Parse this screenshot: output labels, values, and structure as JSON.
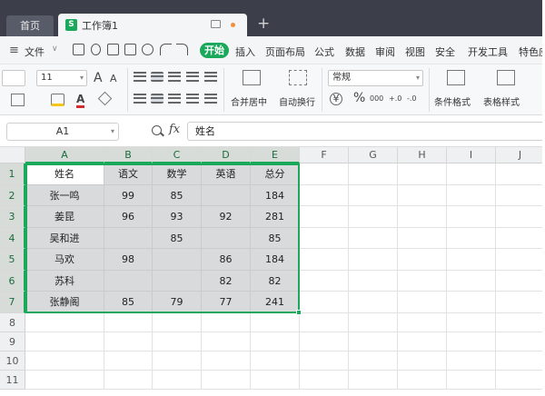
{
  "tabs": {
    "home": "首页",
    "doc_icon": "S",
    "doc_title": "工作簿1",
    "new_tab": "+"
  },
  "menubar": {
    "menu_icon": "≡",
    "file": "文件",
    "file_caret": "∨",
    "start": "开始",
    "items": [
      "插入",
      "页面布局",
      "公式",
      "数据",
      "审阅",
      "视图",
      "安全",
      "开发工具",
      "特色应"
    ]
  },
  "ribbon": {
    "font_size": "11",
    "increase_font": "A",
    "decrease_font": "A",
    "merge_center": "合并居中",
    "wrap_text": "自动换行",
    "number_format": "常规",
    "currency": "¥",
    "percent": "%",
    "thousands": "000",
    "decimal_inc": "+.0",
    "decimal_dec": "-.0",
    "conditional_format": "条件格式",
    "table_style": "表格样式",
    "font_color_letter": "A"
  },
  "formula_bar": {
    "name_box": "A1",
    "fx": "fx",
    "value": "姓名"
  },
  "grid": {
    "columns": [
      "A",
      "B",
      "C",
      "D",
      "E",
      "F",
      "G",
      "H",
      "I",
      "J"
    ],
    "rows": [
      "1",
      "2",
      "3",
      "4",
      "5",
      "6",
      "7",
      "8",
      "9",
      "10",
      "11"
    ],
    "cells": [
      [
        "姓名",
        "语文",
        "数学",
        "英语",
        "总分"
      ],
      [
        "张一鸣",
        "99",
        "85",
        "",
        "184"
      ],
      [
        "姜昆",
        "96",
        "93",
        "92",
        "281"
      ],
      [
        "吴和进",
        "",
        "85",
        "",
        "85"
      ],
      [
        "马欢",
        "98",
        "",
        "86",
        "184"
      ],
      [
        "苏科",
        "",
        "",
        "82",
        "82"
      ],
      [
        "张静阁",
        "85",
        "79",
        "77",
        "241"
      ]
    ]
  },
  "colors": {
    "accent": "#1aa85b",
    "tab_bar": "#3c3f4a",
    "selection_fill": "#d9dadb"
  }
}
